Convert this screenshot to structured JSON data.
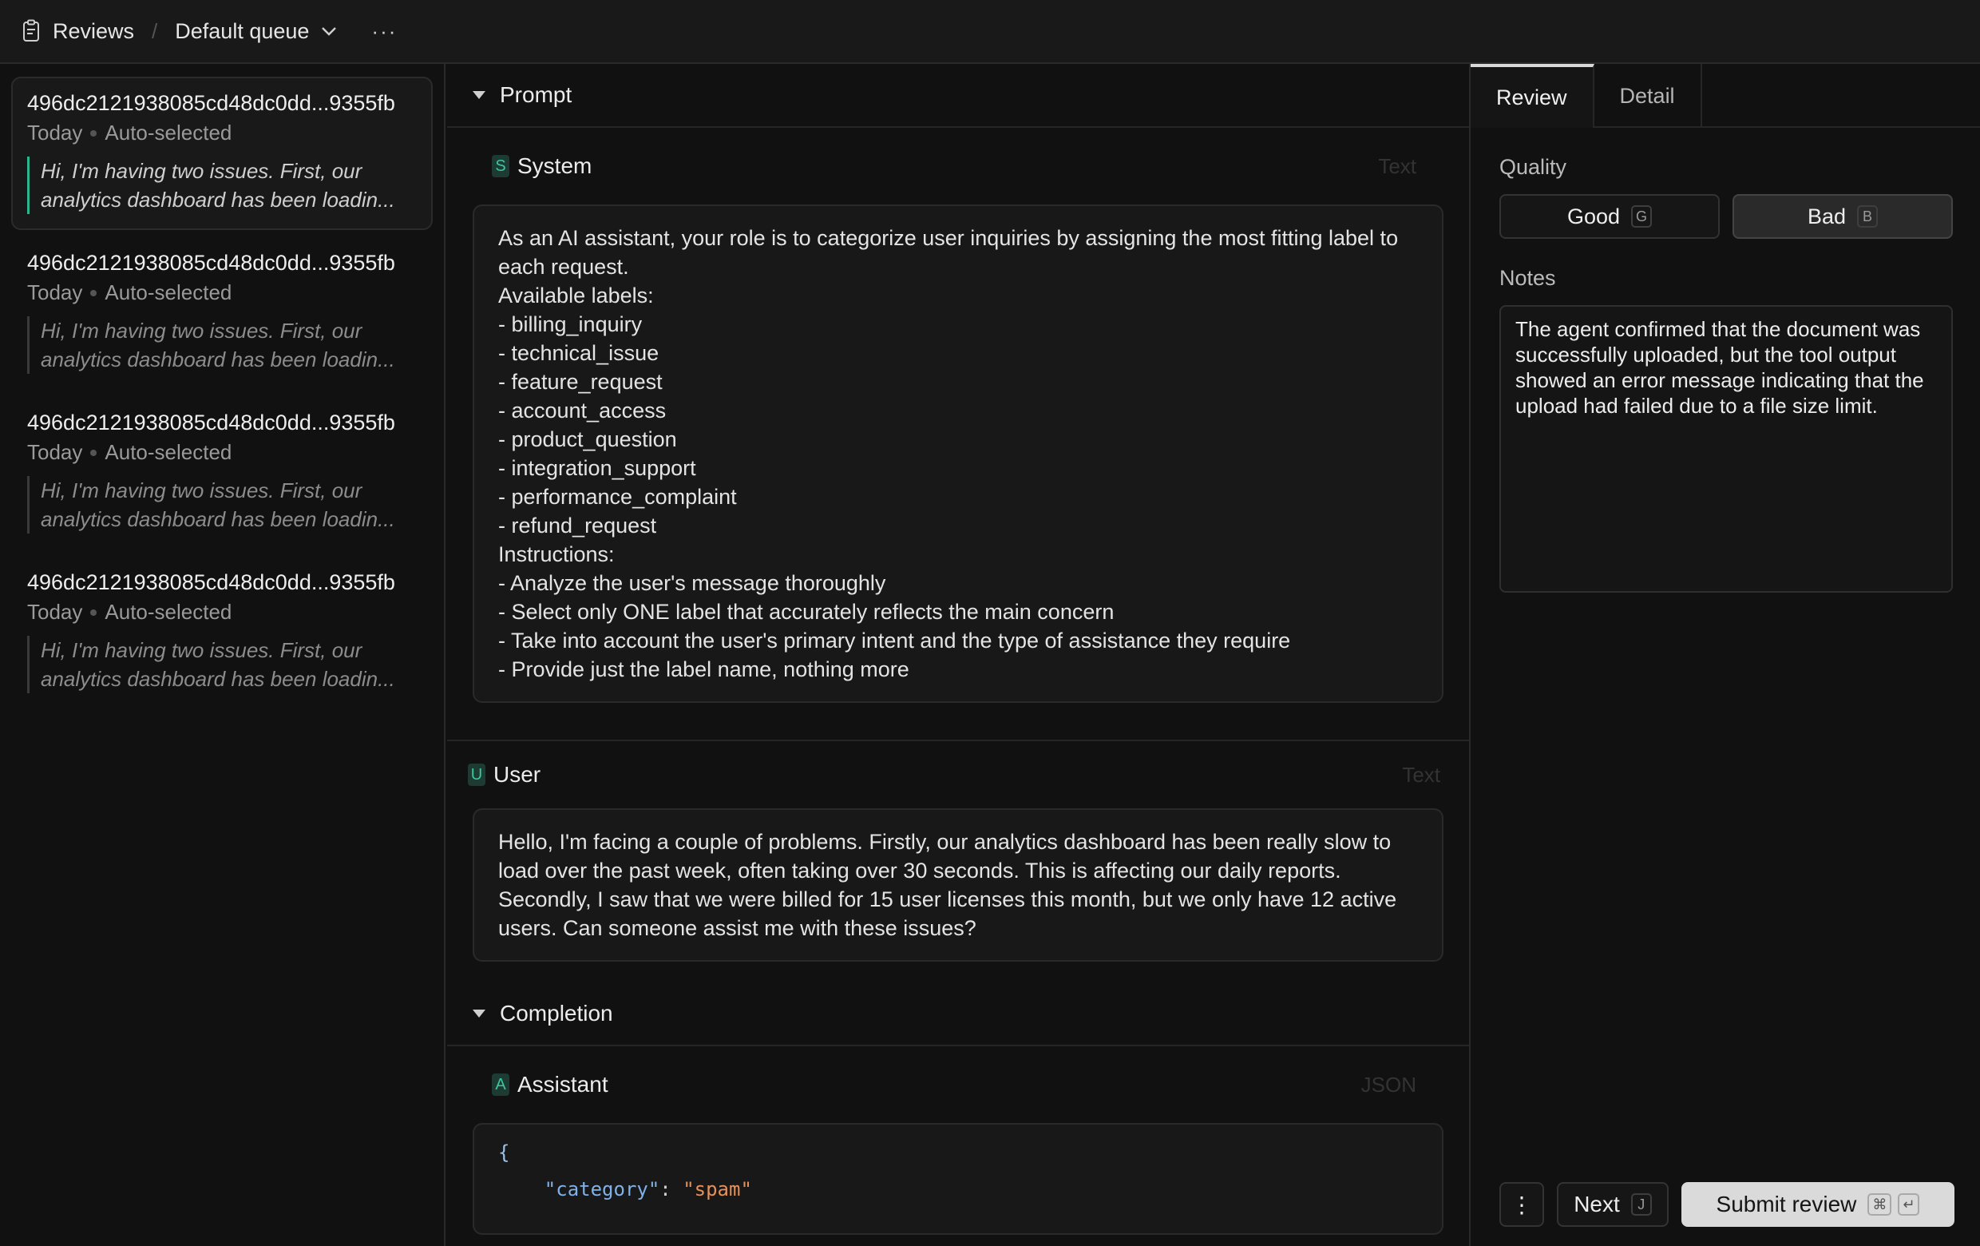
{
  "topbar": {
    "title": "Reviews",
    "separator": "/",
    "queue": "Default queue",
    "more": "···"
  },
  "list": {
    "items": [
      {
        "id": "496dc2121938085cd48dc0dd...9355fb",
        "date": "Today",
        "status": "Auto-selected",
        "preview": "Hi, I'm having two issues. First, our analytics dashboard has been loadin..."
      },
      {
        "id": "496dc2121938085cd48dc0dd...9355fb",
        "date": "Today",
        "status": "Auto-selected",
        "preview": "Hi, I'm having two issues. First, our analytics dashboard has been loadin..."
      },
      {
        "id": "496dc2121938085cd48dc0dd...9355fb",
        "date": "Today",
        "status": "Auto-selected",
        "preview": "Hi, I'm having two issues. First, our analytics dashboard has been loadin..."
      },
      {
        "id": "496dc2121938085cd48dc0dd...9355fb",
        "date": "Today",
        "status": "Auto-selected",
        "preview": "Hi, I'm having two issues. First, our analytics dashboard has been loadin..."
      }
    ]
  },
  "prompt": {
    "title": "Prompt",
    "system": {
      "badge": "S",
      "role": "System",
      "format": "Text",
      "content": "As an AI assistant, your role is to categorize user inquiries by assigning the most fitting label to each request.\nAvailable labels:\n- billing_inquiry\n- technical_issue\n- feature_request\n- account_access\n- product_question\n- integration_support\n- performance_complaint\n- refund_request\nInstructions:\n- Analyze the user's message thoroughly\n- Select only ONE label that accurately reflects the main concern\n- Take into account the user's primary intent and the type of assistance they require\n- Provide just the label name, nothing more"
    },
    "user": {
      "badge": "U",
      "role": "User",
      "format": "Text",
      "content": "Hello, I'm facing a couple of problems. Firstly, our analytics dashboard has been really slow to load over the past week, often taking over 30 seconds. This is affecting our daily reports. Secondly, I saw that we were billed for 15 user licenses this month, but we only have 12 active users. Can someone assist me with these issues?"
    }
  },
  "completion": {
    "title": "Completion",
    "assistant": {
      "badge": "A",
      "role": "Assistant",
      "format": "JSON",
      "brace": "{",
      "key": "\"category\"",
      "colon": ": ",
      "value": "\"spam\""
    }
  },
  "review": {
    "tabs": [
      "Review",
      "Detail"
    ],
    "quality_label": "Quality",
    "good_label": "Good",
    "good_key": "G",
    "bad_label": "Bad",
    "bad_key": "B",
    "selected": "Bad",
    "notes_label": "Notes",
    "notes_value": "The agent confirmed that the document was successfully uploaded, but the tool output showed an error message indicating that the upload had failed due to a file size limit.",
    "kebab": "⋮",
    "next_label": "Next",
    "next_key": "J",
    "submit_label": "Submit review",
    "submit_key1": "⌘",
    "submit_key2": "↵"
  }
}
